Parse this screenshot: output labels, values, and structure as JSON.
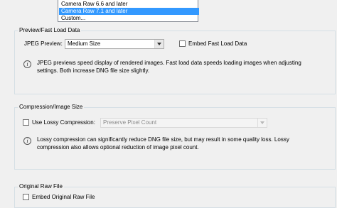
{
  "compatibility_list": {
    "items": [
      "Camera Raw 6.6 and later",
      "Camera Raw 7.1 and later",
      "Custom..."
    ],
    "selected_index": 1
  },
  "preview_group": {
    "title": "Preview/Fast Load Data",
    "jpeg_preview_label": "JPEG Preview:",
    "jpeg_preview_value": "Medium Size",
    "embed_fast_load_label": "Embed Fast Load Data",
    "embed_fast_load_checked": false,
    "info_line1": "JPEG previews speed display of rendered images.  Fast load data speeds loading images when adjusting",
    "info_line2": "settings.  Both increase DNG file size slightly."
  },
  "compression_group": {
    "title": "Compression/Image Size",
    "lossy_label": "Use Lossy Compression:",
    "lossy_checked": false,
    "size_value": "Preserve Pixel Count",
    "info_line1": "Lossy compression can significantly reduce DNG file size, but may result in some quality loss.  Lossy",
    "info_line2": "compression also allows optional reduction of image pixel count."
  },
  "original_raw_group": {
    "title": "Original Raw File",
    "embed_label": "Embed Original Raw File",
    "embed_checked": false
  },
  "colors": {
    "selection": "#3399ff",
    "group_border": "#d5dfe5",
    "background": "#f0f0f0"
  }
}
